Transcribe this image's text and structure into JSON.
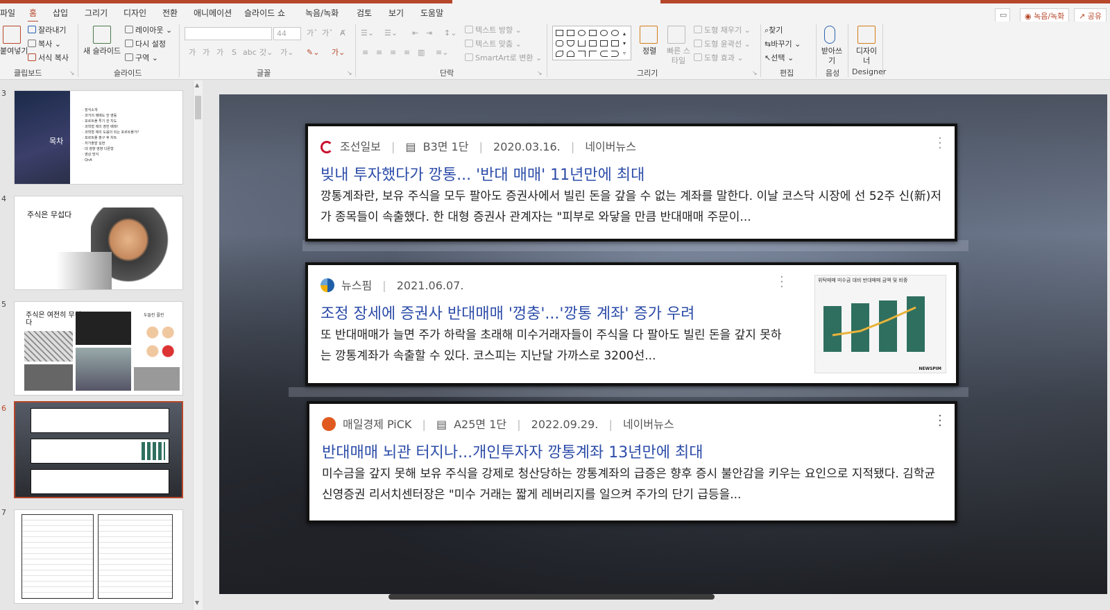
{
  "tabs": [
    "파일",
    "홈",
    "삽입",
    "그리기",
    "디자인",
    "전환",
    "애니메이션",
    "슬라이드 쇼",
    "녹음/녹화",
    "검토",
    "보기",
    "도움말"
  ],
  "top_buttons": {
    "record": "녹음/녹화",
    "share": "공유"
  },
  "ribbon": {
    "clipboard": {
      "paste": "붙여넣기",
      "cut": "잘라내기",
      "copy": "복사",
      "format_painter": "서식 복사",
      "label": "클립보드"
    },
    "slides": {
      "new_slide": "새 슬라이드",
      "layout": "레이아웃",
      "reset": "다시 설정",
      "section": "구역",
      "label": "슬라이드"
    },
    "font": {
      "size": "44",
      "label": "글꼴"
    },
    "paragraph": {
      "text_direction": "텍스트 방향",
      "align_text": "텍스트 맞춤",
      "smartart": "SmartArt로 변환",
      "label": "단락"
    },
    "drawing": {
      "arrange": "정렬",
      "quick_styles": "빠른 스타일",
      "shape_fill": "도형 채우기",
      "shape_outline": "도형 윤곽선",
      "shape_effects": "도형 효과",
      "label": "그리기"
    },
    "editing": {
      "find": "찾기",
      "replace": "바꾸기",
      "select": "선택",
      "label": "편집"
    },
    "voice": {
      "dictate": "받아쓰기",
      "label": "음성"
    },
    "designer": {
      "designer_ideas": "디자이너",
      "label": "Designer"
    }
  },
  "thumbnails": [
    {
      "num": "3",
      "title": "목차",
      "items": [
        "· 장식소개",
        "· 과거의 매매도 한 영동",
        "· 포르트폴 투기 한 치도",
        "· 과학형 제의 영한 배태!",
        "· 과학형 제의 도움의 되는 포르트폴가?",
        "· 포르트폴 출구 후 차트",
        "· 저가출발 실현",
        "· 대 영향 영향 다론형",
        "· 영상 방식",
        "· QnA"
      ]
    },
    {
      "num": "4",
      "title": "주식은 무섭다"
    },
    {
      "num": "5",
      "title": "주식은 여전히 무섭다",
      "side_label": "두들린 플린"
    },
    {
      "num": "6"
    },
    {
      "num": "7"
    }
  ],
  "cards": [
    {
      "source": "조선일보",
      "page": "B3면 1단",
      "date": "2020.03.16.",
      "portal": "네이버뉴스",
      "headline": "빚내 투자했다가 깡통... '반대 매매' 11년만에 최대",
      "body": "깡통계좌란, 보유 주식을 모두 팔아도 증권사에서 빌린 돈을 갚을 수 없는 계좌를 말한다. 이날 코스닥 시장에 선 52주 신(新)저가 종목들이 속출했다. 한 대형 증권사 관계자는 \"피부로 와닿을 만큼 반대매매 주문이...",
      "logo_color": "#c8102e"
    },
    {
      "source": "뉴스핌",
      "date": "2021.06.07.",
      "headline": "조정 장세에 증권사 반대매매 '껑충'...'깡통 계좌' 증가 우려",
      "body": "또 반대매매가 늘면 주가 하락을 초래해 미수거래자들이 주식을 다 팔아도 빌린 돈을 갚지 못하는 깡통계좌가 속출할 수 있다. 코스피는 지난달 가까스로 3200선...",
      "logo_color": "#1f5fa8",
      "chart_caption": "위탁매매 미수금 대비 반대매매 금액 및 비중",
      "chart_brand": "NEWSPIM"
    },
    {
      "source": "매일경제 PiCK",
      "page": "A25면 1단",
      "date": "2022.09.29.",
      "portal": "네이버뉴스",
      "headline": "반대매매 뇌관 터지나...개인투자자 깡통계좌 13년만에 최대",
      "body": "미수금을 갚지 못해 보유 주식을 강제로 청산당하는 깡통계좌의 급증은 향후 증시 불안감을 키우는 요인으로 지적됐다. 김학균 신영증권 리서치센터장은 \"미수 거래는 짧게 레버리지를 일으켜 주가의 단기 급등을...",
      "logo_color": "#e05a1f"
    }
  ]
}
